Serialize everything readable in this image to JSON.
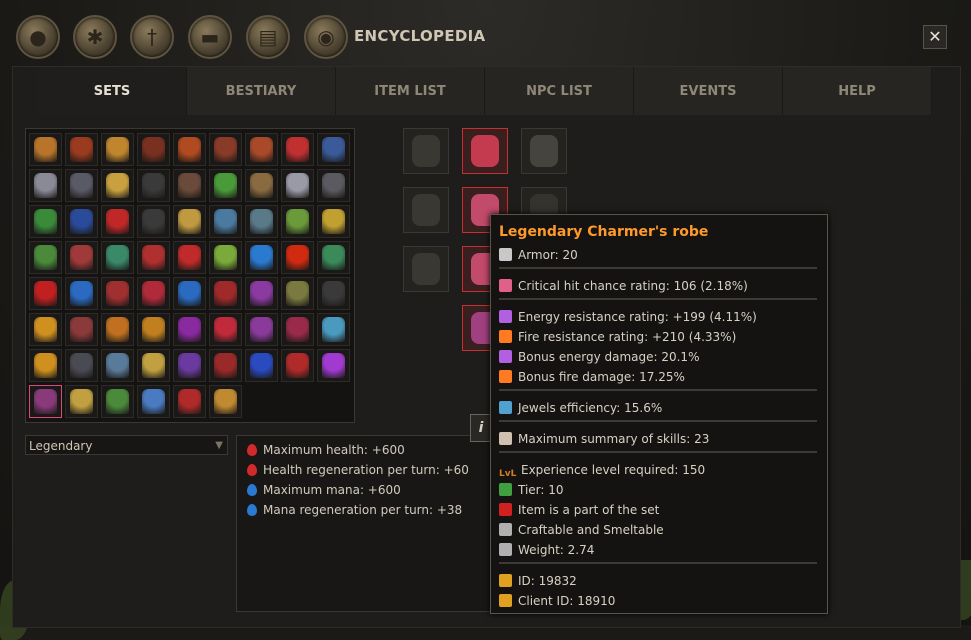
{
  "window": {
    "title": "ENCYCLOPEDIA",
    "close_label": "✕"
  },
  "top_icons": [
    "bag-icon",
    "beetle-icon",
    "sword-icon",
    "anvil-icon",
    "scroll-icon",
    "eye-icon"
  ],
  "tabs": [
    {
      "label": "SETS",
      "active": true
    },
    {
      "label": "BESTIARY",
      "active": false
    },
    {
      "label": "ITEM LIST",
      "active": false
    },
    {
      "label": "NPC LIST",
      "active": false
    },
    {
      "label": "EVENTS",
      "active": false
    },
    {
      "label": "HELP",
      "active": false
    }
  ],
  "filter": {
    "value": "Legendary",
    "arrow": "▼"
  },
  "set_bonuses": [
    {
      "text": "Maximum health: +600",
      "color": "#d22a2a"
    },
    {
      "text": "Health regeneration per turn: +60",
      "color": "#d22a2a"
    },
    {
      "text": "Maximum mana: +600",
      "color": "#2a7ad2"
    },
    {
      "text": "Mana regeneration per turn: +38",
      "color": "#2a7ad2"
    }
  ],
  "info_button": "i",
  "tooltip": {
    "title": "Legendary Charmer's robe",
    "lines": [
      {
        "text": "Armor: 20",
        "icon": "armor-icon",
        "color": "#c8c8c8"
      },
      {
        "text": "Critical hit chance rating: 106 (2.18%)",
        "icon": "crit-icon",
        "color": "#e0608a"
      },
      {
        "text": "Energy resistance rating: +199 (4.11%)",
        "icon": "energy-icon",
        "color": "#b060e0"
      },
      {
        "text": "Fire resistance rating: +210 (4.33%)",
        "icon": "fire-icon",
        "color": "#ff7a20"
      },
      {
        "text": "Bonus energy damage: 20.1%",
        "icon": "energy-icon",
        "color": "#b060e0"
      },
      {
        "text": "Bonus fire damage: 17.25%",
        "icon": "fire-icon",
        "color": "#ff7a20"
      },
      {
        "text": "Jewels efficiency: 15.6%",
        "icon": "jewel-icon",
        "color": "#50a0d0"
      },
      {
        "text": "Maximum summary of skills: 23",
        "icon": "skills-icon",
        "color": "#d0c0b0"
      },
      {
        "text": "Experience level required: 150",
        "icon": "level-icon",
        "color": "#d08020",
        "icon_text": "LvL"
      },
      {
        "text": "Tier: 10",
        "icon": "tier-icon",
        "color": "#40a040"
      },
      {
        "text": "Item is a part of the set",
        "icon": "set-icon",
        "color": "#d02020"
      },
      {
        "text": "Craftable and Smeltable",
        "icon": "hammer-icon",
        "color": "#b0b0b0"
      },
      {
        "text": "Weight: 2.74",
        "icon": "weight-icon",
        "color": "#b0b0b0"
      },
      {
        "text": "ID: 19832",
        "icon": "star-icon",
        "color": "#e0a020"
      },
      {
        "text": "Client ID: 18910",
        "icon": "star-icon",
        "color": "#e0a020"
      }
    ]
  },
  "colors": {
    "accent": "#ff9a2a",
    "selected_border": "#c63030"
  }
}
